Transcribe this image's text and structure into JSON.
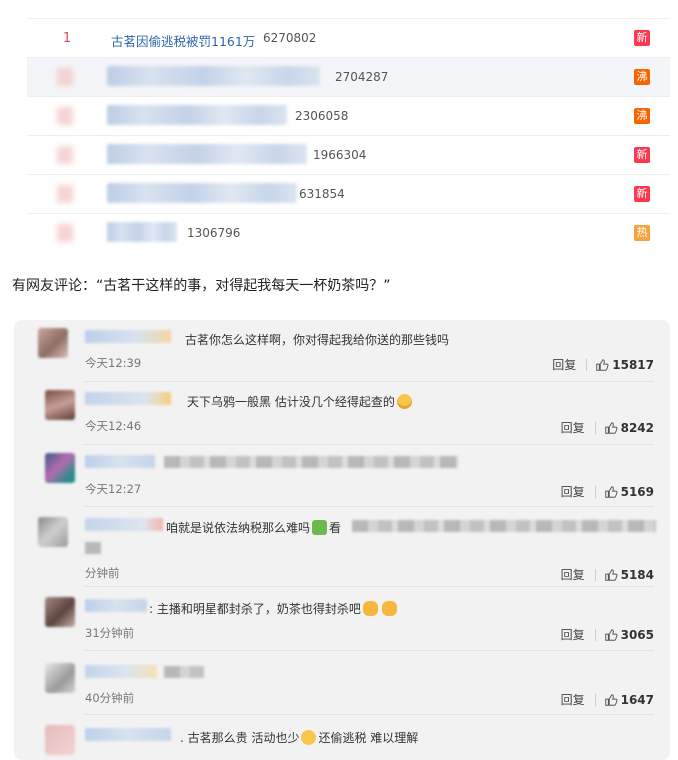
{
  "hot_search": {
    "rows": [
      {
        "rank": "1",
        "topic": "古茗因偷逃税被罚1161万",
        "count": "6270802",
        "tag": "新",
        "tag_type": "new"
      },
      {
        "rank": "",
        "topic": "",
        "count": "2704287",
        "tag": "沸",
        "tag_type": "boil"
      },
      {
        "rank": "",
        "topic": "",
        "count": "2306058",
        "tag": "沸",
        "tag_type": "boil"
      },
      {
        "rank": "",
        "topic": "",
        "count": "1966304",
        "tag": "新",
        "tag_type": "new"
      },
      {
        "rank": "",
        "topic": "",
        "count": "631854",
        "tag": "新",
        "tag_type": "new"
      },
      {
        "rank": "",
        "topic": "",
        "count": "1306796",
        "tag": "热",
        "tag_type": "hot"
      }
    ]
  },
  "intro": "有网友评论：“古茗干这样的事，对得起我每天一杯奶茶吗？”",
  "comments": [
    {
      "text": "古茗你怎么这样啊，你对得起我给你送的那些钱吗",
      "time": "今天12:39",
      "reply": "回复",
      "likes": "15817"
    },
    {
      "text": "天下乌鸦一般黑 估计没几个经得起查的",
      "time": "今天12:46",
      "reply": "回复",
      "likes": "8242"
    },
    {
      "text": "",
      "time": "今天12:27",
      "reply": "回复",
      "likes": "5169"
    },
    {
      "text": "咱就是说依法纳税那么难吗",
      "text_suffix": "看",
      "time": "分钟前",
      "reply": "回复",
      "likes": "5184"
    },
    {
      "text": "主播和明星都封杀了，奶茶也得封杀吧",
      "time": "31分钟前",
      "reply": "回复",
      "likes": "3065"
    },
    {
      "text": "",
      "time": "40分钟前",
      "reply": "回复",
      "likes": "1647"
    },
    {
      "text": "古茗那么贵 活动也少",
      "text_suffix": "还偷逃税 难以理解",
      "time": "",
      "reply": "",
      "likes": ""
    }
  ],
  "icons": {
    "like": "thumbs-up-icon"
  },
  "colors": {
    "link": "#2f66a8",
    "rank": "#e8454f",
    "tag_new": "#ff3852",
    "tag_boil": "#f86400",
    "tag_hot": "#f7a23a",
    "panel": "#f2f2f2"
  }
}
